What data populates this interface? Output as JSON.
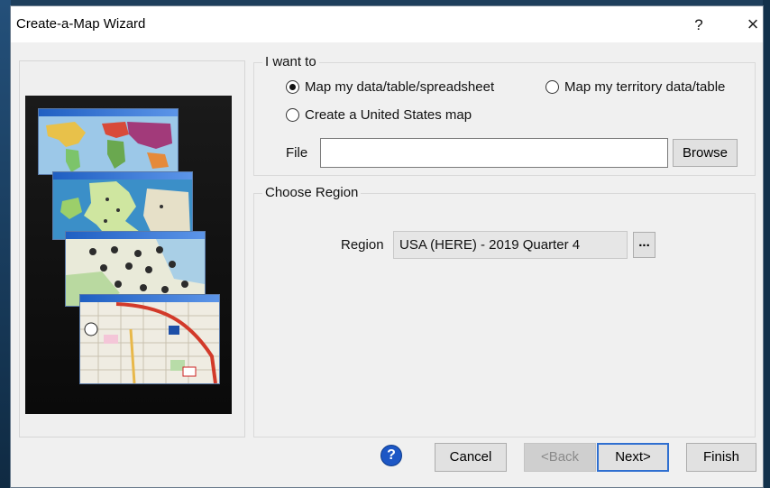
{
  "window": {
    "title": "Create-a-Map Wizard",
    "help_label": "?",
    "close_label": "×"
  },
  "i_want_to": {
    "label": "I want to",
    "options": [
      {
        "label": "Map my data/table/spreadsheet",
        "selected": true
      },
      {
        "label": "Map my territory data/table",
        "selected": false
      },
      {
        "label": "Create a United States map",
        "selected": false
      }
    ],
    "file_label": "File",
    "file_value": "",
    "browse_label": "Browse"
  },
  "choose_region": {
    "label": "Choose Region",
    "region_label": "Region",
    "region_value": "USA (HERE) - 2019 Quarter 4",
    "ellipsis_label": "..."
  },
  "footer": {
    "help_glyph": "?",
    "cancel_label": "Cancel",
    "back_label": "<Back",
    "next_label": "Next>",
    "finish_label": "Finish"
  },
  "colors": {
    "accent": "#2f6fd0",
    "dialog_bg": "#f0f0f0",
    "help_icon": "#1d57c5"
  }
}
